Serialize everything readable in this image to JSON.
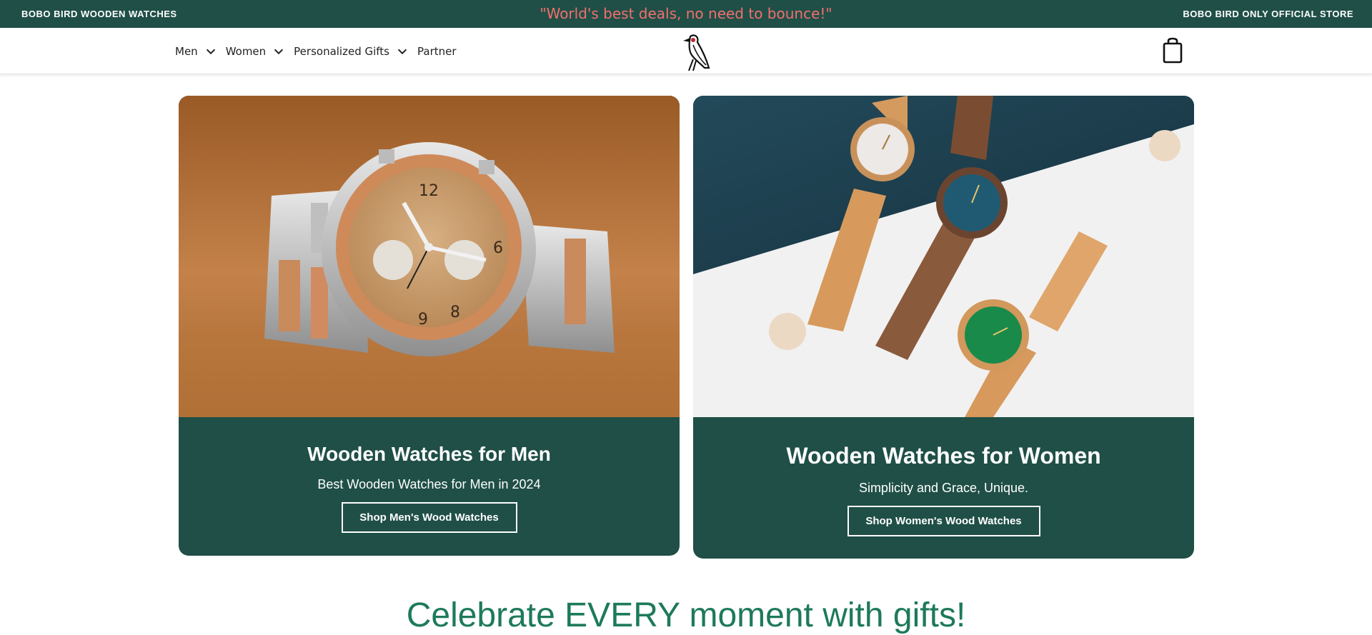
{
  "announcement": {
    "left": "BOBO BIRD WOODEN WATCHES",
    "center": "\"World's best deals, no need to bounce!\"",
    "right": "BOBO BIRD ONLY OFFICIAL STORE"
  },
  "nav": {
    "items": [
      {
        "label": "Men",
        "has_dropdown": true
      },
      {
        "label": "Women",
        "has_dropdown": true
      },
      {
        "label": "Personalized Gifts",
        "has_dropdown": true
      },
      {
        "label": "Partner",
        "has_dropdown": false
      }
    ],
    "logo_icon": "bird-logo-icon",
    "cart_icon": "shopping-bag-icon"
  },
  "cards": {
    "men": {
      "title": "Wooden Watches for Men",
      "subtitle": "Best Wooden Watches for Men in 2024",
      "button": "Shop Men's Wood Watches"
    },
    "women": {
      "title": "Wooden Watches for Women",
      "subtitle": "Simplicity and Grace, Unique.",
      "button": "Shop Women's Wood Watches"
    }
  },
  "headline": "Celebrate EVERY moment with gifts!",
  "colors": {
    "brand_green": "#1f4f47",
    "announcement_accent": "#f26f6c",
    "headline_green": "#1d7a5a"
  }
}
